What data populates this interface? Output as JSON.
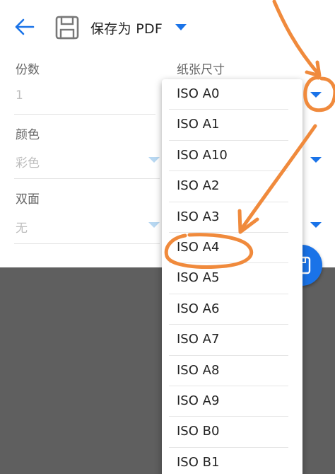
{
  "toolbar": {
    "back_icon": "arrow-back-icon",
    "printer_icon": "save-floppy-icon",
    "printer_name": "保存为 PDF"
  },
  "fields": {
    "copies": {
      "label": "份数",
      "value": "1"
    },
    "paper_size": {
      "label": "纸张尺寸"
    },
    "color": {
      "label": "颜色",
      "value": "彩色"
    },
    "duplex": {
      "label": "双面",
      "value": "无"
    }
  },
  "paper_menu": {
    "items": [
      "ISO A0",
      "ISO A1",
      "ISO A10",
      "ISO A2",
      "ISO A3",
      "ISO A4",
      "ISO A5",
      "ISO A6",
      "ISO A7",
      "ISO A8",
      "ISO A9",
      "ISO B0",
      "ISO B1"
    ],
    "highlighted": "ISO A4"
  },
  "colors": {
    "accent": "#1a73e8",
    "annotation": "#f08a3c",
    "preview_bg": "#5f5f5f"
  }
}
